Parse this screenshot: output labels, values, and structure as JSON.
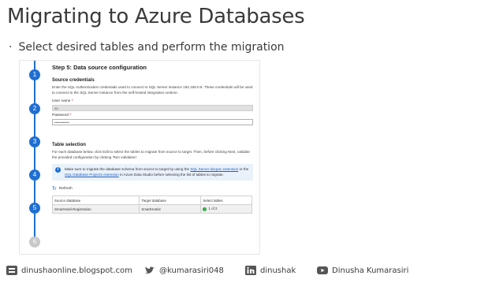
{
  "slide": {
    "title": "Migrating to Azure Databases",
    "bullet": "Select desired tables and perform the migration"
  },
  "wizard": {
    "steps": [
      "1",
      "2",
      "3",
      "4",
      "5",
      "6"
    ],
    "active_steps": 5,
    "step_title": "Step 5: Data source configuration",
    "source_credentials": {
      "heading": "Source credentials",
      "description": "Enter the SQL Authentication credentials used to connect to SQL Server instance 192.168.0.6. These credentials will be used to connect to the SQL Server instance from the self-hosted integration runtime.",
      "username_label": "User name",
      "username_value": "sa",
      "password_label": "Password",
      "password_value": "••••••••••••"
    },
    "table_selection": {
      "heading": "Table selection",
      "description": "For each database below, click Edit to select the tables to migrate from source to target. Then, before clicking Next, validate the provided configuration by clicking 'Run validation'.",
      "info_text_1": "Make sure to migrate the database schema from source to target by using the",
      "info_link_1": "SQL Server dacpac extension",
      "info_text_2": "or the",
      "info_link_2": "SQL Database Projects extension",
      "info_text_3": "in Azure Data Studio before selecting the list of tables to migrate.",
      "refresh_label": "Refresh",
      "columns": [
        "Source database",
        "Target database",
        "Select tables"
      ],
      "rows": [
        {
          "source": "SmartHotel.Registration",
          "target": "SmartHotel2",
          "select": "1 of 2"
        }
      ]
    }
  },
  "footer": {
    "blog": "dinushaonline.blogspot.com",
    "twitter": "@kumarasiri048",
    "linkedin": "dinushak",
    "youtube": "Dinusha Kumarasiri"
  },
  "colors": {
    "accent": "#1f6fd1",
    "success": "#2e9e3e"
  }
}
